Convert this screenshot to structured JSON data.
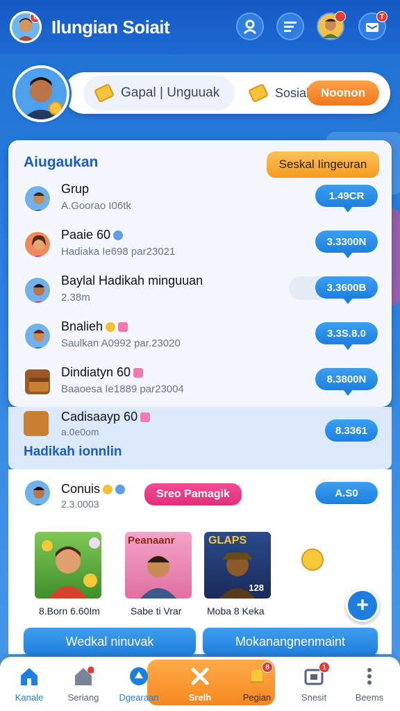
{
  "header": {
    "title": "Ilungian Soiait",
    "notif_badges": [
      "6",
      "T"
    ]
  },
  "profile": {
    "pill_left": "Gapal | Unguuak",
    "pill_middle": "Sosial",
    "pill_button": "Noonon"
  },
  "card": {
    "title": "Aiugaukan",
    "button": "Seskal Iingeuran",
    "rows": [
      {
        "name": "Grup",
        "sub": "A.Goorao I06tk",
        "value": "1.49CR"
      },
      {
        "name": "Paaie 60",
        "sub": "Hadiaka Ie698 par23021",
        "value": "3.3300N"
      },
      {
        "name": "Baylal Hadikah minguuan",
        "sub": "2.38m",
        "value": "3.3600B"
      },
      {
        "name": "Bnalieh",
        "sub": "Saulkan A0992 par.23020",
        "value": "3.3S.8.0"
      },
      {
        "name": "Dindiatyn 60",
        "sub": "Baaoesa Ie1889 par23004",
        "value": "8.3800N"
      }
    ]
  },
  "card2": {
    "row_name": "Cadisaayp 60",
    "row_sub": "a.0e0om",
    "value": "8.3361",
    "section_title": "Hadikah ionnlin"
  },
  "card3": {
    "user_name": "Conuis",
    "user_sub": "2.3.0003",
    "pink_button": "Sreo Pamagik",
    "value": "A.S0",
    "thumbs": [
      {
        "label": "8.Born 6.60Im",
        "title": ""
      },
      {
        "label": "Sabe ti Vrar",
        "title": "Peanaanr"
      },
      {
        "label": "Moba 8 Keka",
        "title": "GLAPS",
        "tag": "128"
      }
    ],
    "btn_left": "Wedkal ninuvak",
    "btn_right": "Mokanangnenmaint"
  },
  "nav": {
    "items": [
      {
        "label": "Kanale",
        "icon": "home-icon"
      },
      {
        "label": "Seriang",
        "icon": "house-alert-icon"
      },
      {
        "label": "Dgearaan",
        "icon": "globe-icon"
      },
      {
        "label": "Srelh",
        "icon": "close-icon"
      },
      {
        "label": "Pegian",
        "icon": "bell-icon",
        "badge": "8"
      },
      {
        "label": "Snesit",
        "icon": "inbox-icon",
        "badge": "1"
      },
      {
        "label": "Beems",
        "icon": "more-icon"
      }
    ]
  },
  "colors": {
    "primary": "#1d69d2",
    "accent": "#f5881f",
    "pill_blue": "#1d7fe0",
    "pink": "#f23b8e"
  }
}
